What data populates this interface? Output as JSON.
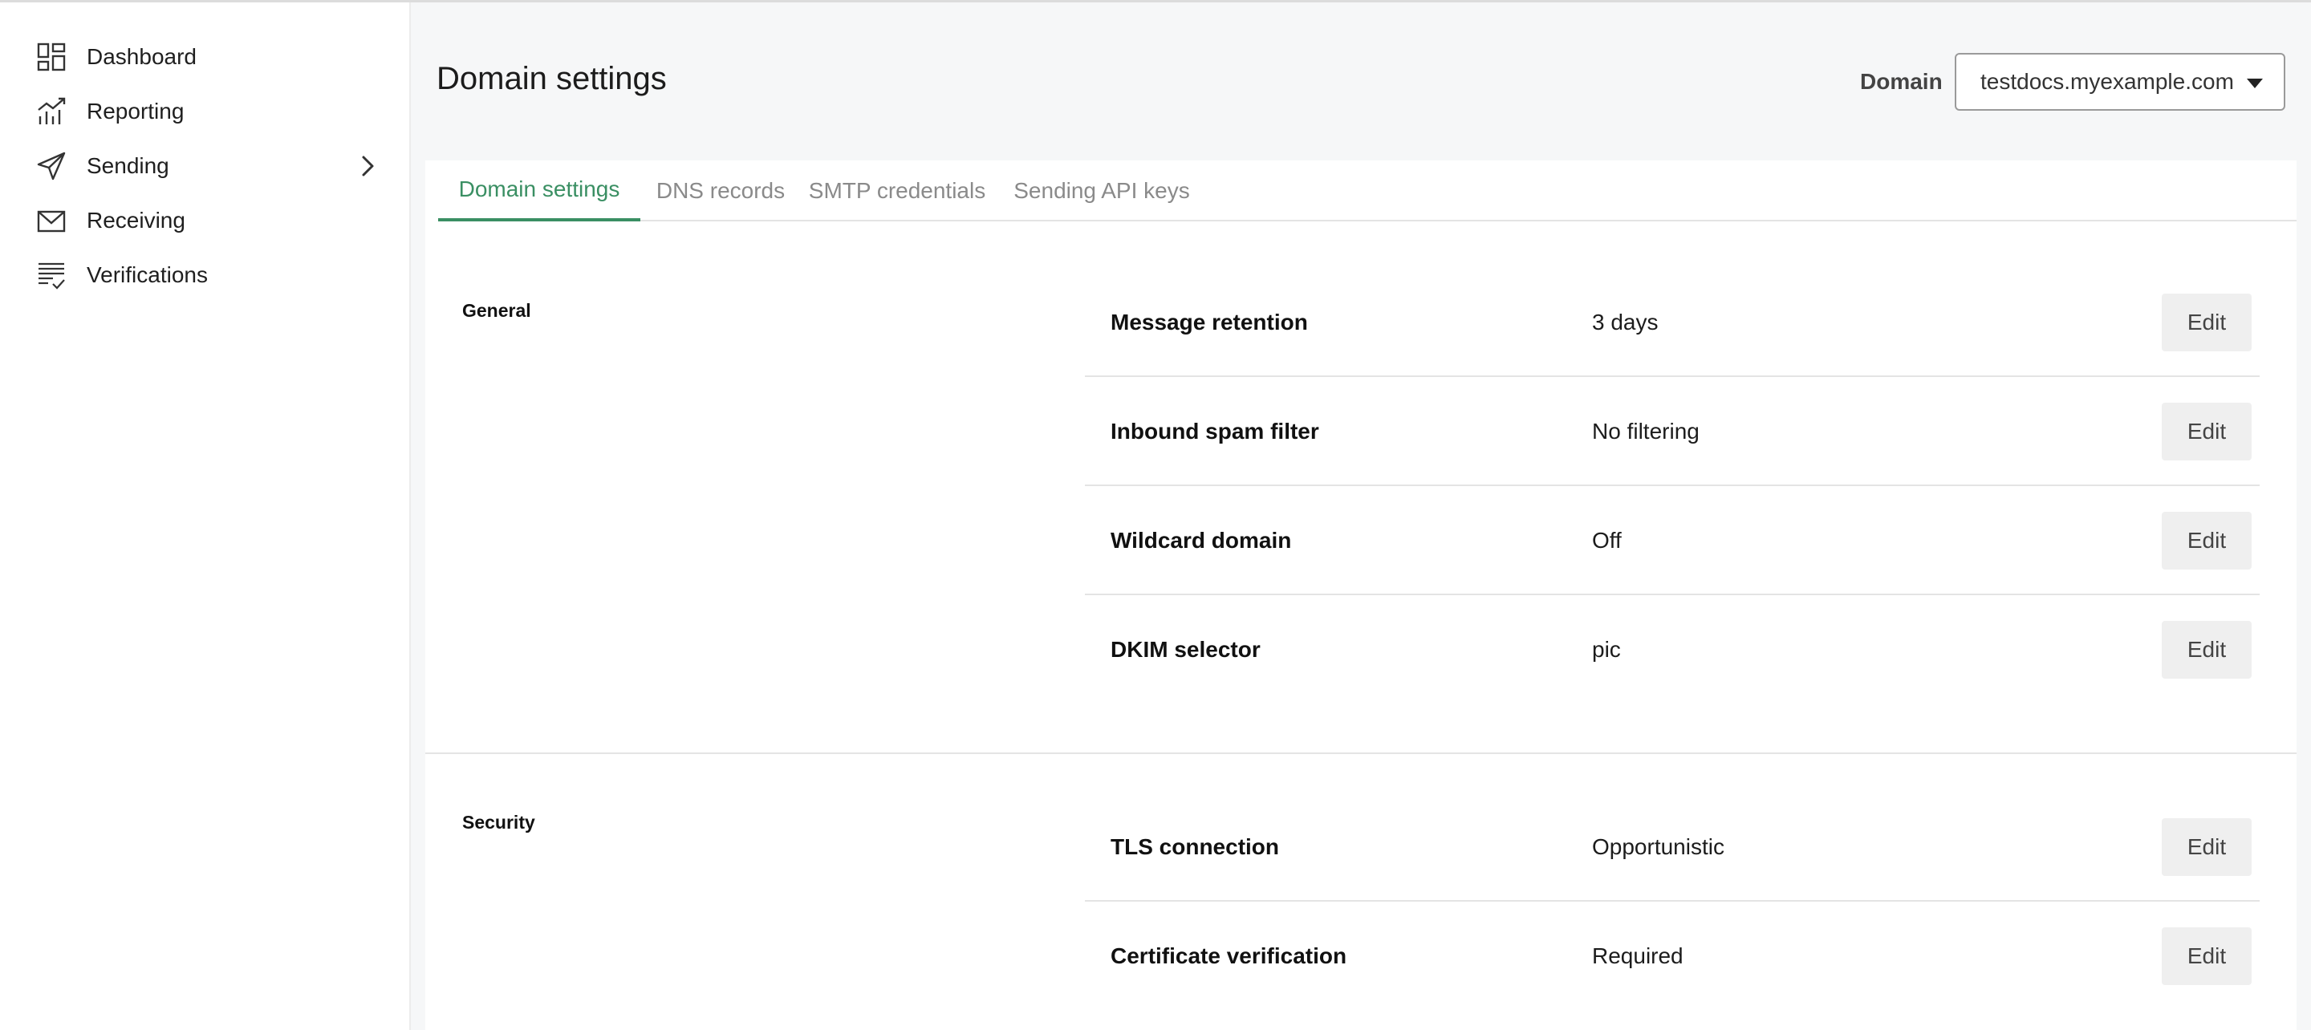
{
  "sidebar": {
    "items": [
      {
        "label": "Dashboard",
        "icon": "dashboard-icon"
      },
      {
        "label": "Reporting",
        "icon": "reporting-chart-icon"
      },
      {
        "label": "Sending",
        "icon": "send-plane-icon",
        "has_children": true
      },
      {
        "label": "Receiving",
        "icon": "envelope-icon"
      },
      {
        "label": "Verifications",
        "icon": "list-check-icon"
      }
    ]
  },
  "header": {
    "title": "Domain settings",
    "domain_label": "Domain",
    "domain_value": "testdocs.myexample.com"
  },
  "tabs": [
    {
      "label": "Domain settings",
      "active": true
    },
    {
      "label": "DNS records",
      "active": false
    },
    {
      "label": "SMTP credentials",
      "active": false
    },
    {
      "label": "Sending API keys",
      "active": false
    }
  ],
  "sections": [
    {
      "label": "General",
      "rows": [
        {
          "name": "Message retention",
          "value": "3 days",
          "action": "Edit"
        },
        {
          "name": "Inbound spam filter",
          "value": "No filtering",
          "action": "Edit"
        },
        {
          "name": "Wildcard domain",
          "value": "Off",
          "action": "Edit"
        },
        {
          "name": "DKIM selector",
          "value": "pic",
          "action": "Edit"
        }
      ]
    },
    {
      "label": "Security",
      "rows": [
        {
          "name": "TLS connection",
          "value": "Opportunistic",
          "action": "Edit"
        },
        {
          "name": "Certificate verification",
          "value": "Required",
          "action": "Edit"
        }
      ]
    }
  ],
  "colors": {
    "accent": "#3a8f63",
    "page_bg": "#f6f7f8",
    "button_bg": "#efefef"
  }
}
